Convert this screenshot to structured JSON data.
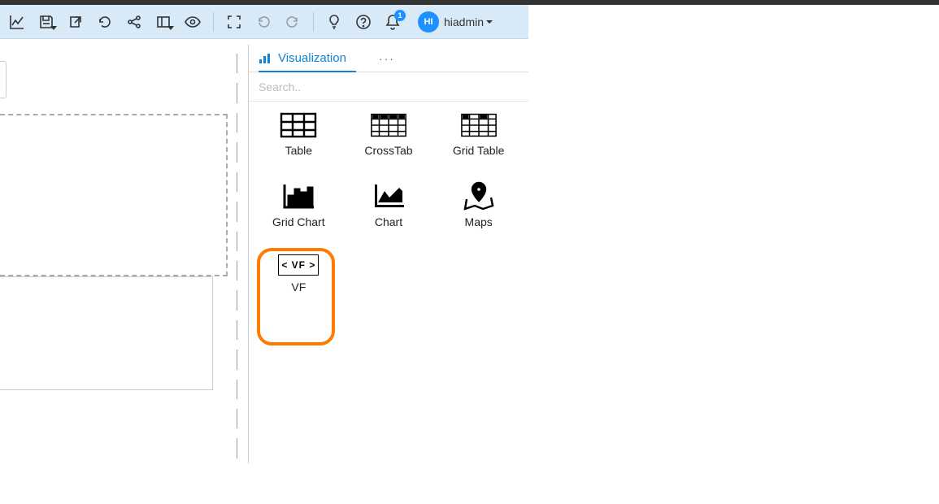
{
  "toolbar": {
    "notif_count": "1",
    "avatar_initials": "HI",
    "username": "hiadmin"
  },
  "panel": {
    "tab_label": "Visualization",
    "more_label": "···",
    "search_placeholder": "Search..",
    "viz": {
      "table": "Table",
      "crosstab": "CrossTab",
      "gridtable": "Grid Table",
      "gridchart": "Grid Chart",
      "chart": "Chart",
      "maps": "Maps",
      "vf": "VF",
      "vf_icon_text": "< VF >"
    }
  }
}
